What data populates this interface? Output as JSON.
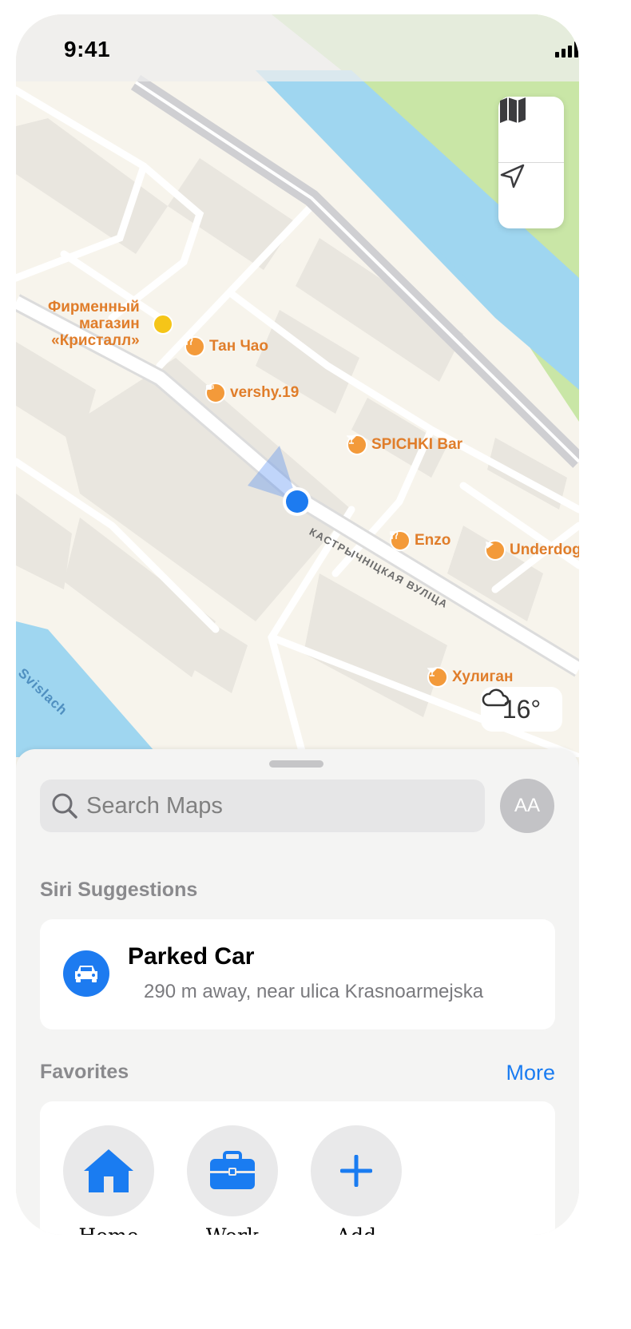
{
  "status_bar": {
    "time": "9:41"
  },
  "map": {
    "pois": {
      "kristall": [
        "Фирменный",
        "магазин",
        "«Кристалл»"
      ],
      "tan_chao": "Тан Чао",
      "vershy": "vershy.19",
      "spichki": "SPICHKI Bar",
      "enzo": "Enzo",
      "underdog": "Underdog",
      "huligan": "Хулиган"
    },
    "street_label": "КАСТРЫЧНІЦКАЯ ВУЛІЦА",
    "river_label": "Svislach",
    "weather": {
      "icon": "cloud-icon",
      "temperature": "16°"
    },
    "colors": {
      "land": "#f7f4ec",
      "park": "#c9e6a6",
      "water": "#9fd6f0",
      "user_location": "#1d7bf0",
      "poi": "#e07d2a"
    }
  },
  "sheet": {
    "search_placeholder": "Search Maps",
    "avatar_initials": "AA",
    "siri_title": "Siri Suggestions",
    "parked_car": {
      "title": "Parked Car",
      "subtitle": "290 m away, near ulica Krasnoarmejska",
      "icon": "car-icon"
    },
    "favorites_title": "Favorites",
    "favorites_more": "More",
    "favorites": [
      {
        "label": "Home",
        "icon": "home-icon"
      },
      {
        "label": "Work",
        "icon": "briefcase-icon"
      },
      {
        "label": "Add",
        "icon": "plus-icon"
      }
    ],
    "accent": "#1a7cf1"
  }
}
